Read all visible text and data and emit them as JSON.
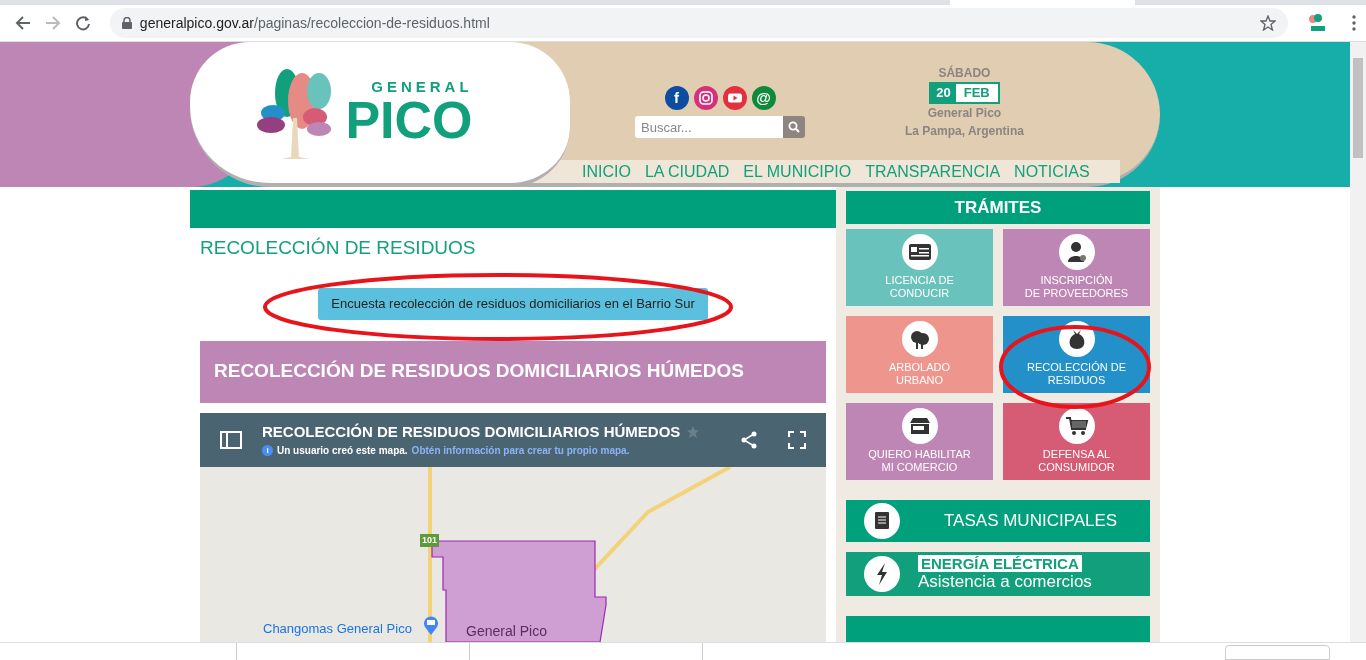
{
  "browser": {
    "url_host": "generalpico.gov.ar",
    "url_path": "/paginas/recoleccion-de-residuos.html",
    "forward_disabled": true
  },
  "header": {
    "facebook_glyph": "f",
    "email_glyph": "@",
    "logo_small": "GENERAL",
    "logo_big": "PICO",
    "search": {
      "placeholder": "Buscar..."
    },
    "date": {
      "day_name": "SÁBADO",
      "day": "20",
      "month": "FEB",
      "city": "General Pico",
      "region": "La Pampa, Argentina"
    },
    "nav": [
      "INICIO",
      "LA CIUDAD",
      "EL MUNICIPIO",
      "TRANSPARENCIA",
      "NOTICIAS"
    ]
  },
  "main": {
    "title": "RECOLECCIÓN DE RESIDUOS",
    "survey_button": "Encuesta recolección de residuos domiciliarios en el Barrio Sur",
    "section_heading": "RECOLECCIÓN DE RESIDUOS DOMICILIARIOS HÚMEDOS",
    "map": {
      "info_glyph": "i",
      "title": "RECOLECCIÓN DE RESIDUOS DOMICILIARIOS HÚMEDOS",
      "info": "Un usuario creó este mapa.",
      "info_link": "Obtén información para crear tu propio mapa.",
      "route": "101",
      "place": "Changomas General Pico",
      "city": "General Pico"
    }
  },
  "sidebar": {
    "heading": "TRÁMITES",
    "tiles": [
      {
        "label": "LICENCIA DE\nCONDUCIR",
        "color": "#6ac2bd",
        "kind": "card"
      },
      {
        "label": "INSCRIPCIÓN\nDE PROVEEDORES",
        "color": "#be86b4",
        "kind": "user"
      },
      {
        "label": "ARBOLADO\nURBANO",
        "color": "#ee968e",
        "kind": "tree"
      },
      {
        "label": "RECOLECCIÓN DE\nRESIDUOS",
        "color": "#2490c9",
        "kind": "bag"
      },
      {
        "label": "QUIERO HABILITAR\nMI COMERCIO",
        "color": "#be86b4",
        "kind": "store"
      },
      {
        "label": "DEFENSA AL\nCONSUMIDOR",
        "color": "#d65b74",
        "kind": "cart"
      }
    ],
    "tasas": "TASAS MUNICIPALES",
    "energy_heading": "ENERGÍA ELÉCTRICA",
    "energy_sub": "Asistencia a comercios"
  }
}
